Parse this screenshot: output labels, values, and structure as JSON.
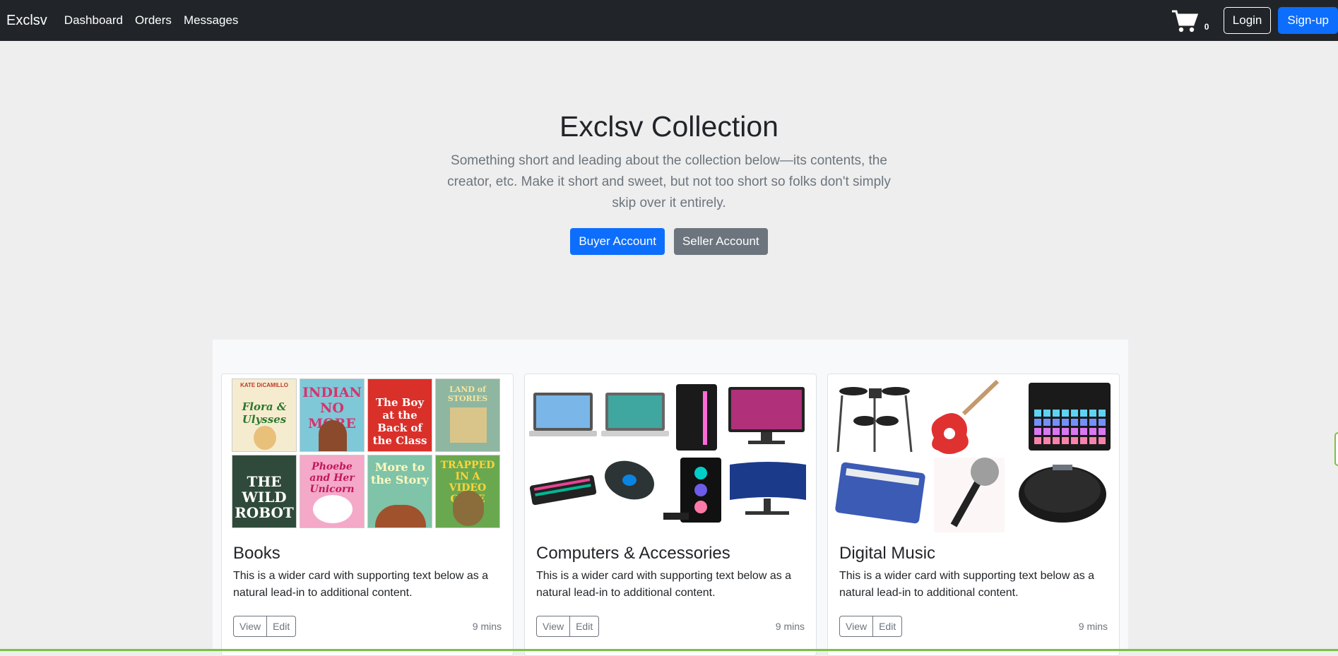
{
  "navbar": {
    "brand": "Exclsv",
    "links": [
      "Dashboard",
      "Orders",
      "Messages"
    ],
    "cart_count": "0",
    "login_label": "Login",
    "signup_label": "Sign-up"
  },
  "hero": {
    "title": "Exclsv Collection",
    "lead": "Something short and leading about the collection below—its contents, the creator, etc. Make it short and sweet, but not too short so folks don't simply skip over it entirely.",
    "buyer_label": "Buyer Account",
    "seller_label": "Seller Account"
  },
  "cards": [
    {
      "title": "Books",
      "text": "This is a wider card with supporting text below as a natural lead-in to additional content.",
      "view_label": "View",
      "edit_label": "Edit",
      "time": "9 mins",
      "book_titles": [
        "Flora & Ulysses",
        "INDIAN NO MORE",
        "The Boy at the Back of the Class",
        "LAND of STORIES",
        "THE WILD ROBOT",
        "Phoebe and Her Unicorn",
        "More to the Story",
        "TRAPPED IN A VIDEO GAME"
      ],
      "book_author": "KATE DiCAMILLO"
    },
    {
      "title": "Computers & Accessories",
      "text": "This is a wider card with supporting text below as a natural lead-in to additional content.",
      "view_label": "View",
      "edit_label": "Edit",
      "time": "9 mins"
    },
    {
      "title": "Digital Music",
      "text": "This is a wider card with supporting text below as a natural lead-in to additional content.",
      "view_label": "View",
      "edit_label": "Edit",
      "time": "9 mins"
    }
  ],
  "colors": {
    "navbar": "#212529",
    "primary": "#0d6efd",
    "secondary": "#6c757d",
    "accent_green": "#7bc043"
  }
}
